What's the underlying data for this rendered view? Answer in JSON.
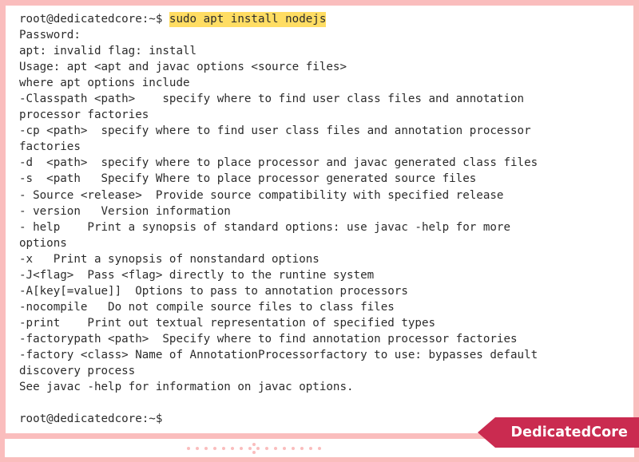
{
  "terminal": {
    "prompt": "root@dedicatedcore:~$",
    "command": "sudo apt install nodejs",
    "lines": [
      {
        "kind": "prompt-command",
        "prompt": "root@dedicatedcore:~$ ",
        "command": "sudo apt install nodejs"
      },
      {
        "kind": "text",
        "text": "Password:"
      },
      {
        "kind": "text",
        "text": "apt: invalid flag: install"
      },
      {
        "kind": "text",
        "text": "Usage: apt <apt and javac options <source files>"
      },
      {
        "kind": "text",
        "text": "where apt options include"
      },
      {
        "kind": "text",
        "text": "-Classpath <path>    specify where to find user class files and annotation"
      },
      {
        "kind": "text",
        "text": "processor factories"
      },
      {
        "kind": "text",
        "text": "-cp <path>  specify where to find user class files and annotation processor"
      },
      {
        "kind": "text",
        "text": "factories"
      },
      {
        "kind": "text",
        "text": "-d  <path>  specify where to place processor and javac generated class files"
      },
      {
        "kind": "text",
        "text": "-s  <path   Specify Where to place processor generated source files"
      },
      {
        "kind": "text",
        "text": "- Source <release>  Provide source compatibility with specified release"
      },
      {
        "kind": "text",
        "text": "- version   Version information"
      },
      {
        "kind": "text",
        "text": "- help    Print a synopsis of standard options: use javac -help for more"
      },
      {
        "kind": "text",
        "text": "options"
      },
      {
        "kind": "text",
        "text": "-x   Print a synopsis of nonstandard options"
      },
      {
        "kind": "text",
        "text": "-J<flag>  Pass <flag> directly to the runtine system"
      },
      {
        "kind": "text",
        "text": "-A[key[=value]]  Options to pass to annotation processors"
      },
      {
        "kind": "text",
        "text": "-nocompile   Do not compile source files to class files"
      },
      {
        "kind": "text",
        "text": "-print    Print out textual representation of specified types"
      },
      {
        "kind": "text",
        "text": "-factorypath <path>  Specify where to find annotation processor factories"
      },
      {
        "kind": "text",
        "text": "-factory <class> Name of AnnotationProcessorfactory to use: bypasses default"
      },
      {
        "kind": "text",
        "text": "discovery process"
      },
      {
        "kind": "text",
        "text": "See javac -help for information on javac options."
      },
      {
        "kind": "text",
        "text": ""
      },
      {
        "kind": "text",
        "text": "root@dedicatedcore:~$"
      }
    ]
  },
  "footer": {
    "ornament": {
      "left_dots": 7,
      "right_dots": 7,
      "cluster_dots": 4
    }
  },
  "brand": {
    "label": "DedicatedCore"
  },
  "colors": {
    "frame_pink": "#fabdbd",
    "brand_crimson": "#ca2b50",
    "highlight_yellow": "#ffdd63",
    "terminal_text": "#2b2b2b",
    "terminal_background": "#ffffff"
  }
}
